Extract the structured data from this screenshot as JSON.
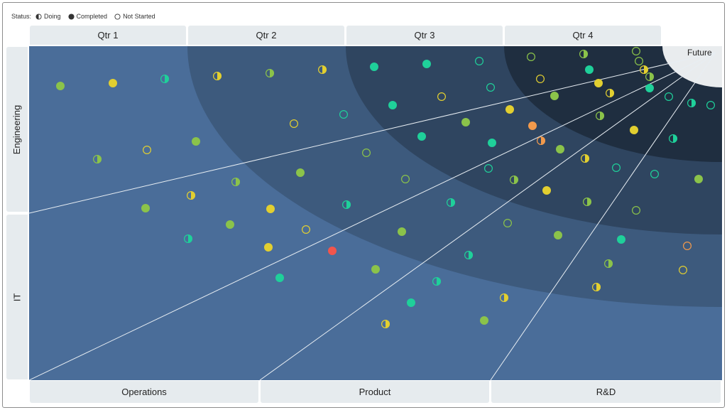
{
  "legend": {
    "title": "Status:",
    "items": [
      {
        "label": "Doing",
        "icon": "half-filled-circle-icon"
      },
      {
        "label": "Completed",
        "icon": "filled-circle-icon"
      },
      {
        "label": "Not Started",
        "icon": "empty-circle-icon"
      }
    ]
  },
  "quarters": [
    "Qtr 1",
    "Qtr 2",
    "Qtr 3",
    "Qtr 4"
  ],
  "future_label": "Future",
  "rows": [
    "Engineering",
    "IT"
  ],
  "sectors": [
    "Operations",
    "Product",
    "R&D"
  ],
  "colors": {
    "band_q1": "#4a6d99",
    "band_q2": "#3d5a7d",
    "band_q3": "#2f4560",
    "band_q4": "#1f2e40",
    "future": "#e9ecee",
    "header_bg": "#e6ebee",
    "green": "#8bc34a",
    "teal": "#1fd09a",
    "yellow": "#e2cf30",
    "orange": "#f29a4c",
    "red": "#f2554c"
  },
  "status_values": [
    "doing",
    "completed",
    "not_started"
  ]
}
